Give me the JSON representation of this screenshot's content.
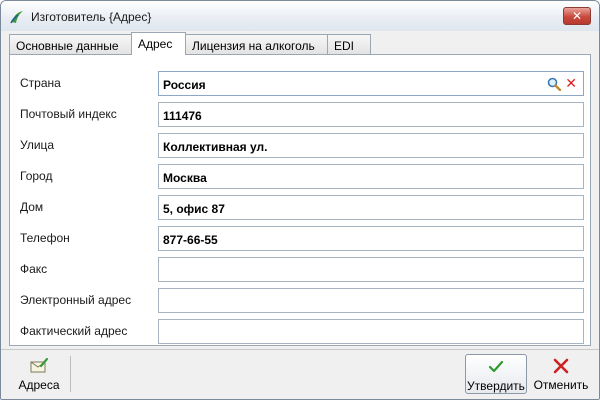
{
  "window": {
    "title": "Изготовитель {Адрес}",
    "close_label": "✕"
  },
  "tabs": [
    {
      "label": "Основные данные",
      "active": false
    },
    {
      "label": "Адрес",
      "active": true
    },
    {
      "label": "Лицензия на алкоголь",
      "active": false
    },
    {
      "label": "EDI",
      "active": false
    }
  ],
  "form": {
    "country": {
      "label": "Страна",
      "value": "Россия"
    },
    "postal_code": {
      "label": "Почтовый индекс",
      "value": "111476"
    },
    "street": {
      "label": "Улица",
      "value": "Коллективная ул."
    },
    "city": {
      "label": "Город",
      "value": "Москва"
    },
    "house": {
      "label": "Дом",
      "value": "5, офис 87"
    },
    "phone": {
      "label": "Телефон",
      "value": "877-66-55"
    },
    "fax": {
      "label": "Факс",
      "value": ""
    },
    "email": {
      "label": "Электронный адрес",
      "value": ""
    },
    "actual_address": {
      "label": "Фактический адрес",
      "value": ""
    }
  },
  "toolbar": {
    "addresses_label": "Адреса",
    "confirm_label": "Утвердить",
    "cancel_label": "Отменить"
  },
  "icons": {
    "app": "app-logo-icon",
    "search": "magnifier-icon",
    "clear": "red-x-icon",
    "addresses": "envelope-pencil-icon",
    "confirm": "green-check-icon",
    "cancel": "red-x-icon"
  },
  "colors": {
    "accent_red": "#cc2222",
    "accent_green": "#2e9a2e",
    "border": "#a7b4c2"
  }
}
